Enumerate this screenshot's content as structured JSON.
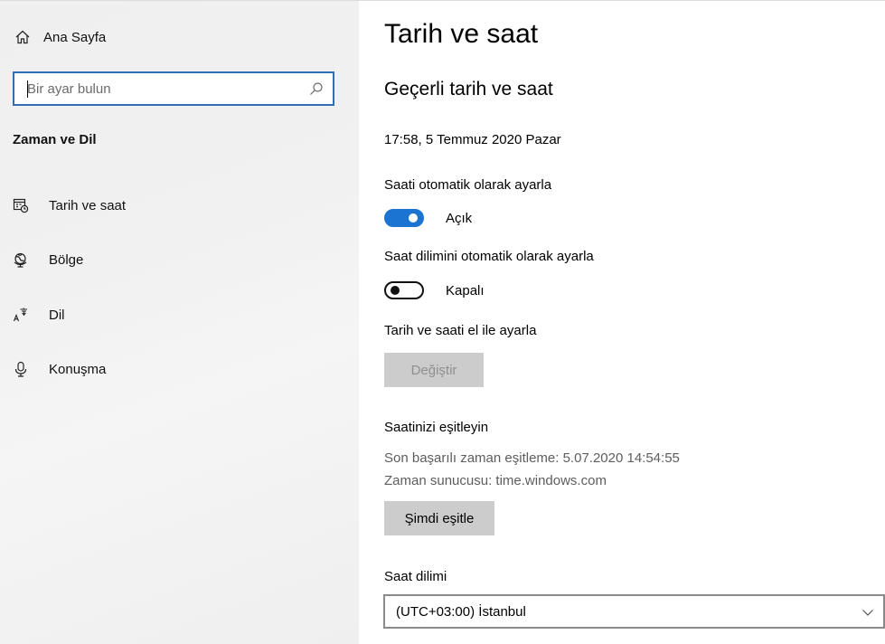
{
  "sidebar": {
    "home_label": "Ana Sayfa",
    "search_placeholder": "Bir ayar bulun",
    "section_title": "Zaman ve Dil",
    "items": [
      {
        "label": "Tarih ve saat",
        "icon": "calendar-clock-icon"
      },
      {
        "label": "Bölge",
        "icon": "globe-region-icon"
      },
      {
        "label": "Dil",
        "icon": "language-icon"
      },
      {
        "label": "Konuşma",
        "icon": "microphone-icon"
      }
    ]
  },
  "main": {
    "title": "Tarih ve saat",
    "current_section_title": "Geçerli tarih ve saat",
    "current_datetime": "17:58, 5 Temmuz 2020 Pazar",
    "auto_time": {
      "label": "Saati otomatik olarak ayarla",
      "state": "Açık",
      "on": true
    },
    "auto_timezone": {
      "label": "Saat dilimini otomatik olarak ayarla",
      "state": "Kapalı",
      "on": false
    },
    "manual": {
      "label": "Tarih ve saati el ile ayarla",
      "button": "Değiştir"
    },
    "sync": {
      "title": "Saatinizi eşitleyin",
      "last_sync": "Son başarılı zaman eşitleme:  5.07.2020 14:54:55",
      "server": "Zaman sunucusu:  time.windows.com",
      "button": "Şimdi eşitle"
    },
    "timezone": {
      "label": "Saat dilimi",
      "value": "(UTC+03:00) İstanbul"
    }
  },
  "colors": {
    "accent": "#1c74d2",
    "search_border": "#2f6eb5"
  }
}
